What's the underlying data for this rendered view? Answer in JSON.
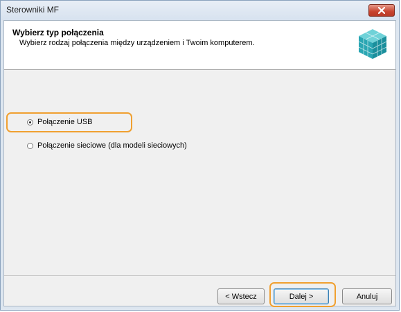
{
  "window": {
    "title": "Sterowniki MF"
  },
  "header": {
    "title": "Wybierz typ połączenia",
    "subtitle": "Wybierz rodzaj połączenia między urządzeniem i Twoim komputerem."
  },
  "options": [
    {
      "label": "Połączenie USB",
      "selected": true
    },
    {
      "label": "Połączenie sieciowe (dla modeli sieciowych)",
      "selected": false
    }
  ],
  "buttons": {
    "back": "< Wstecz",
    "next": "Dalej >",
    "cancel": "Anuluj"
  },
  "colors": {
    "highlight": "#f0a030",
    "close_button": "#c8442f"
  }
}
